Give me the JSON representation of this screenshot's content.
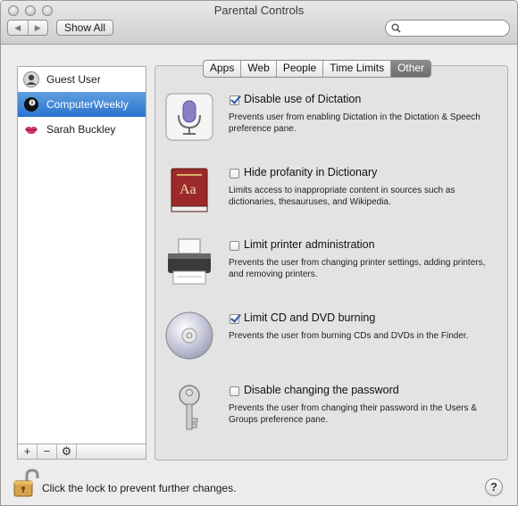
{
  "window": {
    "title": "Parental Controls"
  },
  "toolbar": {
    "back_glyph": "◀",
    "forward_glyph": "▶",
    "show_all_label": "Show All",
    "search_placeholder": ""
  },
  "users": [
    {
      "name": "Guest User",
      "icon": "guest-user-avatar-icon"
    },
    {
      "name": "ComputerWeekly",
      "icon": "8-ball-avatar-icon",
      "selected": true
    },
    {
      "name": "Sarah Buckley",
      "icon": "lips-avatar-icon"
    }
  ],
  "list_controls": {
    "add": "+",
    "remove": "−",
    "action": "⚙"
  },
  "tabs": [
    {
      "label": "Apps"
    },
    {
      "label": "Web"
    },
    {
      "label": "People"
    },
    {
      "label": "Time Limits"
    },
    {
      "label": "Other",
      "active": true
    }
  ],
  "options": [
    {
      "label": "Disable use of Dictation",
      "checked": true,
      "description": "Prevents user from enabling Dictation in the Dictation & Speech preference pane.",
      "icon": "microphone-icon"
    },
    {
      "label": "Hide profanity in Dictionary",
      "checked": false,
      "description": "Limits access to inappropriate content in sources such as dictionaries, thesauruses, and Wikipedia.",
      "icon": "dictionary-book-icon",
      "book_text": "Aa"
    },
    {
      "label": "Limit printer administration",
      "checked": false,
      "description": "Prevents the user from changing printer settings, adding printers, and removing printers.",
      "icon": "printer-icon"
    },
    {
      "label": "Limit CD and DVD burning",
      "checked": true,
      "description": "Prevents the user from burning CDs and DVDs in the Finder.",
      "icon": "cd-disc-icon"
    },
    {
      "label": "Disable changing the password",
      "checked": false,
      "description": "Prevents the user from changing their password in the Users & Groups preference pane.",
      "icon": "key-icon"
    }
  ],
  "footer": {
    "lock_text": "Click the lock to prevent further changes.",
    "help_label": "?"
  },
  "colors": {
    "selection": "#2b73cf",
    "active_tab": "#7a7a7a",
    "checkmark": "#2a58a8"
  }
}
